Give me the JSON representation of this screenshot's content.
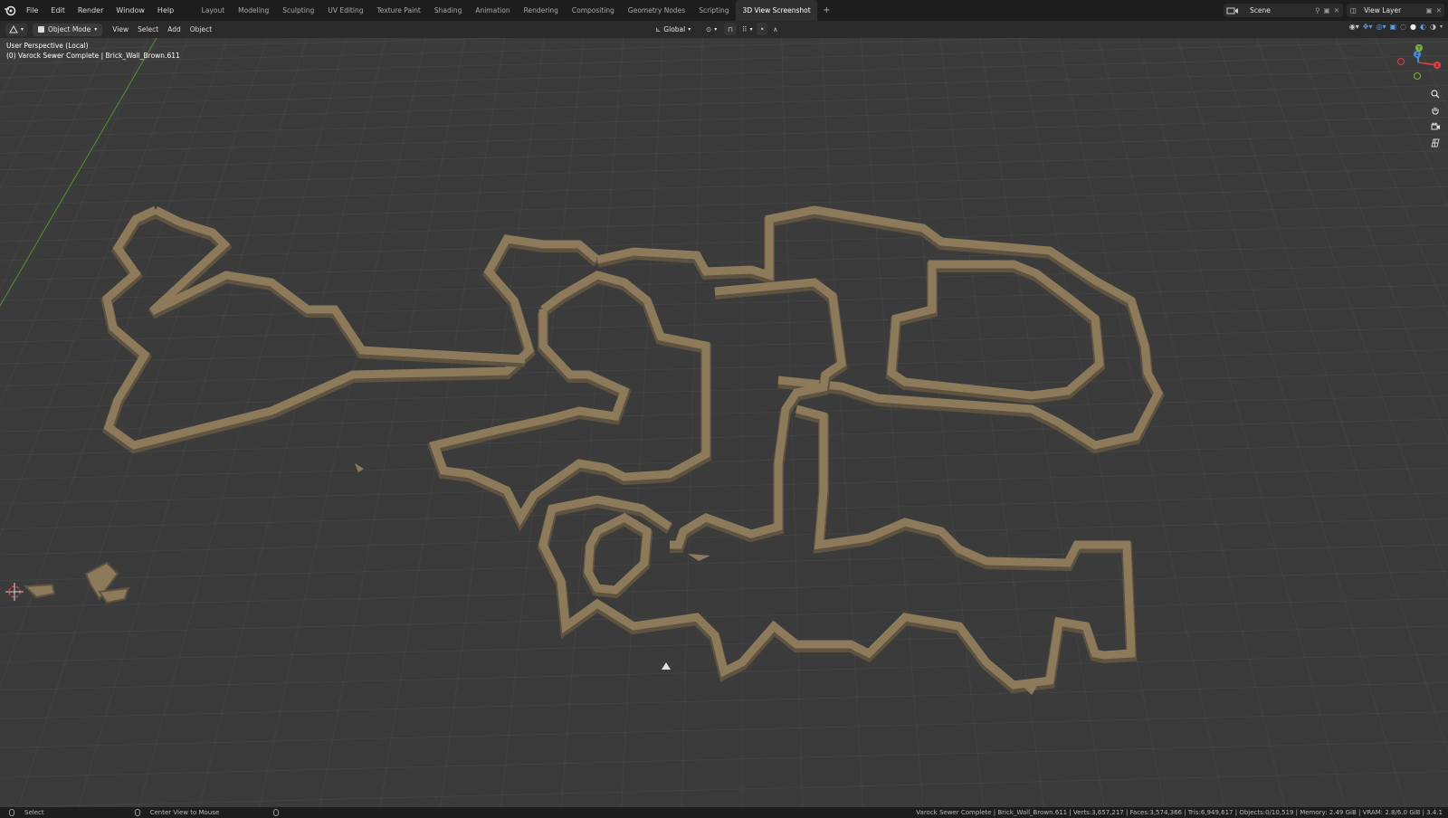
{
  "app": {
    "menus": [
      "File",
      "Edit",
      "Render",
      "Window",
      "Help"
    ],
    "workspace_tabs": [
      "Layout",
      "Modeling",
      "Sculpting",
      "UV Editing",
      "Texture Paint",
      "Shading",
      "Animation",
      "Rendering",
      "Compositing",
      "Geometry Nodes",
      "Scripting",
      "3D View Screenshot"
    ],
    "active_tab": "3D View Screenshot",
    "scene_name": "Scene",
    "view_layer": "View Layer"
  },
  "header": {
    "mode": "Object Mode",
    "menus": [
      "View",
      "Select",
      "Add",
      "Object"
    ],
    "transform_orientation": "Global"
  },
  "viewport": {
    "perspective_label": "User Perspective (Local)",
    "object_label": "(0) Varock Sewer Complete | Brick_Wall_Brown.611",
    "gizmo_axes": [
      "X",
      "Y",
      "Z"
    ],
    "colors": {
      "background": "#3b3b3b",
      "grid": "#474747",
      "wall_top": "#8c7a5a",
      "wall_side": "#5e5240",
      "y_axis": "#5a8f2a",
      "x_axis": "#e0404a",
      "z_axis": "#4a8bd8",
      "gizmo_y": "#7bb33a"
    }
  },
  "status": {
    "left_action": "Select",
    "middle_action": "Center View to Mouse",
    "stats": "Varock Sewer Complete | Brick_Wall_Brown.611 | Verts:3,657,217 | Faces:3,574,366 | Tris:6,949,617 | Objects:0/10,519 | Memory: 2.49 GiB | VRAM: 2.8/6.0 GiB | 3.4.1"
  }
}
